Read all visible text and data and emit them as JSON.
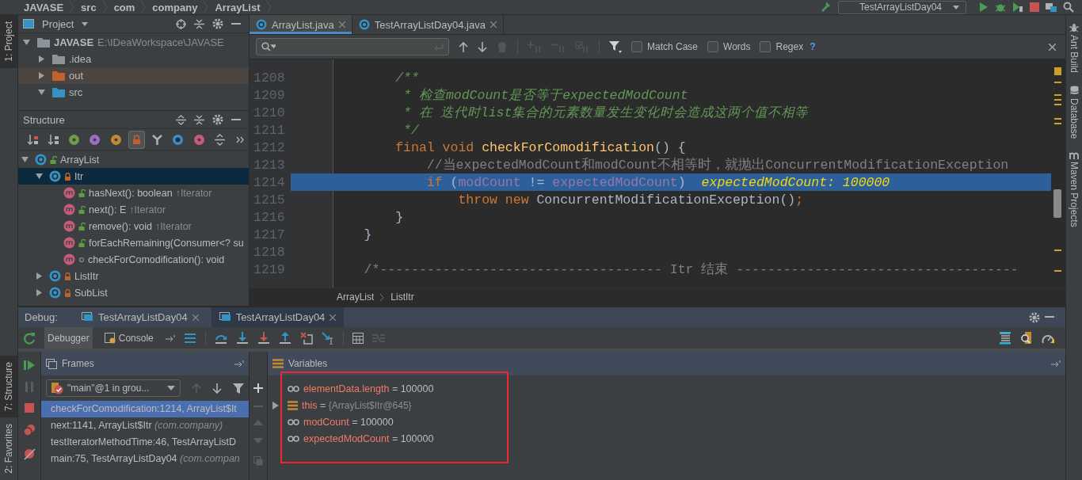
{
  "breadcrumb": {
    "items": [
      "JAVASE",
      "src",
      "com",
      "company",
      "ArrayList"
    ]
  },
  "run_config": {
    "label": "TestArrayListDay04"
  },
  "left_strip": {
    "top": [
      "1: Project"
    ],
    "bottom": [
      "7: Structure",
      "2: Favorites"
    ]
  },
  "right_strip": [
    "Ant Build",
    "Database",
    "Maven Projects"
  ],
  "project_panel": {
    "title": "Project",
    "tree": [
      {
        "name": "JAVASE",
        "path": "E:\\IDeaWorkspace\\JAVASE",
        "color": "#8c9399",
        "expanded": true,
        "selected": false,
        "children": [
          {
            "name": ".idea",
            "color": "#8c9399",
            "expanded": false,
            "selected": false
          },
          {
            "name": "out",
            "color": "#c0622e",
            "expanded": false,
            "selected": true
          },
          {
            "name": "src",
            "color": "#3592c4",
            "expanded": true,
            "selected": false
          }
        ]
      }
    ]
  },
  "structure_panel": {
    "title": "Structure",
    "toolbar": [
      {
        "kind": "sort_visibility",
        "on": false
      },
      {
        "kind": "sort_alpha",
        "on": false
      },
      {
        "kind": "inherited",
        "on": false
      },
      {
        "kind": "properties",
        "on": false
      },
      {
        "kind": "fields",
        "on": false
      },
      {
        "kind": "non_public",
        "on": true
      },
      {
        "kind": "hierarchy",
        "on": false
      },
      {
        "kind": "anonymous",
        "on": false
      },
      {
        "kind": "lambdas",
        "on": false
      },
      {
        "kind": "expand",
        "on": false
      },
      {
        "kind": "more",
        "on": false
      }
    ],
    "tree": [
      {
        "name": "ArrayList",
        "kind": "class",
        "access": {
          "kind": "public"
        },
        "expanded": true,
        "selected": false,
        "children": [
          {
            "name": "Itr",
            "kind": "class",
            "access": {
              "kind": "private"
            },
            "expanded": true,
            "selected": true,
            "children": [
              {
                "name": "hasNext(): boolean",
                "overrides": "↑Iterator",
                "kind": "method",
                "access": {
                  "kind": "public"
                },
                "selected": false
              },
              {
                "name": "next(): E",
                "overrides": "↑Iterator",
                "kind": "method",
                "access": {
                  "kind": "public"
                },
                "selected": false
              },
              {
                "name": "remove(): void",
                "overrides": "↑Iterator",
                "kind": "method",
                "access": {
                  "kind": "public"
                },
                "selected": false
              },
              {
                "name": "forEachRemaining(Consumer<? su",
                "kind": "method",
                "access": {
                  "kind": "public"
                },
                "selected": false
              },
              {
                "name": "checkForComodification(): void",
                "kind": "method",
                "access": {
                  "kind": "package"
                },
                "selected": false
              }
            ]
          },
          {
            "name": "ListItr",
            "kind": "class",
            "access": {
              "kind": "private"
            },
            "expanded": false,
            "selected": false
          },
          {
            "name": "SubList",
            "kind": "class",
            "access": {
              "kind": "private"
            },
            "expanded": false,
            "selected": false
          }
        ]
      }
    ]
  },
  "editor": {
    "tabs": [
      {
        "label": "ArrayList.java",
        "selected": true
      },
      {
        "label": "TestArrayListDay04.java",
        "selected": false
      }
    ],
    "find": {
      "options": [
        {
          "label": "Match Case",
          "checked": false
        },
        {
          "label": "Words",
          "checked": false
        },
        {
          "label": "Regex",
          "checked": false
        }
      ],
      "help": "?"
    },
    "lines": [
      {
        "number": "1208",
        "current": false,
        "tokens": [
          {
            "kind": "doc",
            "text": "        /**"
          }
        ]
      },
      {
        "number": "1209",
        "current": false,
        "tokens": [
          {
            "kind": "doc",
            "text": "         * 检查modCount是否等于expectedModCount"
          }
        ]
      },
      {
        "number": "1210",
        "current": false,
        "tokens": [
          {
            "kind": "doc",
            "text": "         * 在 迭代时list集合的元素数量发生变化时会造成这两个值不相等"
          }
        ]
      },
      {
        "number": "1211",
        "current": false,
        "tokens": [
          {
            "kind": "doc",
            "text": "         */"
          }
        ]
      },
      {
        "number": "1212",
        "current": false,
        "tokens": [
          {
            "kind": "keyword",
            "text": "        final void "
          },
          {
            "kind": "method",
            "text": "checkForComodification"
          },
          {
            "kind": "plain",
            "text": "() {"
          }
        ]
      },
      {
        "number": "1213",
        "current": false,
        "tokens": [
          {
            "kind": "line_comment",
            "text": "            //当expectedModCount和modCount不相等时，就抛出ConcurrentModificationException"
          }
        ]
      },
      {
        "number": "1214",
        "current": true,
        "inline_value": "expectedModCount: 100000",
        "tokens": [
          {
            "kind": "keyword",
            "text": "            if"
          },
          {
            "kind": "plain",
            "text": " ("
          },
          {
            "kind": "field",
            "text": "modCount"
          },
          {
            "kind": "plain",
            "text": " != "
          },
          {
            "kind": "field",
            "text": "expectedModCount"
          },
          {
            "kind": "plain",
            "text": ")"
          }
        ]
      },
      {
        "number": "1215",
        "current": false,
        "tokens": [
          {
            "kind": "keyword",
            "text": "                throw new"
          },
          {
            "kind": "plain",
            "text": " ConcurrentModificationException()"
          },
          {
            "kind": "keyword",
            "text": ";"
          }
        ]
      },
      {
        "number": "1216",
        "current": false,
        "tokens": [
          {
            "kind": "plain",
            "text": "        }"
          }
        ]
      },
      {
        "number": "1217",
        "current": false,
        "tokens": [
          {
            "kind": "plain",
            "text": "    }"
          }
        ]
      },
      {
        "number": "1218",
        "current": false
      },
      {
        "number": "1219",
        "current": false,
        "tokens": [
          {
            "kind": "block_comment",
            "text": "    /*------------------------------------ Itr 结束 ------------------------------------"
          }
        ]
      }
    ],
    "breadcrumbs": [
      "ArrayList",
      "ListItr"
    ]
  },
  "debug": {
    "title": "Debug:",
    "sessions": [
      {
        "label": "TestArrayListDay04",
        "selected": false
      },
      {
        "label": "TestArrayListDay04",
        "selected": true
      }
    ],
    "tabs": [
      {
        "label": "Debugger",
        "selected": true
      },
      {
        "label": "Console",
        "selected": false
      }
    ],
    "frames": {
      "title": "Frames",
      "thread": "\"main\"@1 in grou...",
      "items": [
        {
          "text": "checkForComodification:1214, ArrayList$It",
          "selected": true
        },
        {
          "text": "next:1141, ArrayList$Itr",
          "package": "(com.company)",
          "selected": false
        },
        {
          "text": "testIteratorMethodTime:46, TestArrayListD",
          "selected": false
        },
        {
          "text": "main:75, TestArrayListDay04",
          "package": "(com.compan",
          "selected": false
        }
      ]
    },
    "variables": {
      "title": "Variables",
      "highlight_box": true,
      "items": [
        {
          "kind": "watch",
          "name": "elementData.length",
          "separator": "=",
          "value": "100000"
        },
        {
          "kind": "object",
          "name": "this",
          "separator": "=",
          "value": "{ArrayList$Itr@645}"
        },
        {
          "kind": "watch",
          "name": "modCount",
          "separator": "=",
          "value": "100000"
        },
        {
          "kind": "watch",
          "name": "expectedModCount",
          "separator": "=",
          "value": "100000"
        }
      ]
    }
  }
}
